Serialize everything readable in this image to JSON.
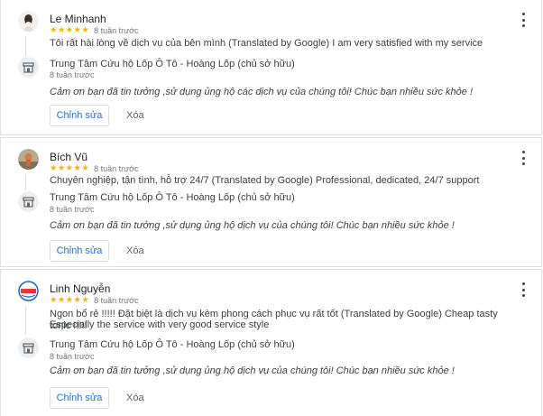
{
  "reviews": [
    {
      "reviewer_name": "Le Minhanh",
      "rating": 5,
      "stars": "★★★★★",
      "time_ago": "8 tuần trước",
      "text": "Tôi rất hài lòng về dịch vụ của bên mình (Translated by Google) I am very satisfied with my service",
      "owner_name": "Trung Tâm Cứu hộ Lốp Ô Tô - Hoàng Lốp (chủ sở hữu)",
      "owner_time_ago": "8 tuần trước",
      "owner_reply": "Cảm ơn bạn đã tin tưởng ,sử dụng ủng hộ các dịch vụ của chúng tôi! Chúc bạn nhiều sức khỏe !",
      "edit_label": "Chỉnh sửa",
      "delete_label": "Xóa"
    },
    {
      "reviewer_name": "Bích Vũ",
      "rating": 5,
      "stars": "★★★★★",
      "time_ago": "8 tuần trước",
      "text": "Chuyên nghiệp, tận tình, hỗ trợ 24/7 (Translated by Google) Professional, dedicated, 24/7 support",
      "owner_name": "Trung Tâm Cứu hộ Lốp Ô Tô - Hoàng Lốp (chủ sở hữu)",
      "owner_time_ago": "8 tuần trước",
      "owner_reply": "Cảm ơn bạn đã tin tưởng ,sử dụng ủng hộ dịch vụ của chúng tôi! Chúc bạn nhiều sức khỏe !",
      "edit_label": "Chỉnh sửa",
      "delete_label": "Xóa"
    },
    {
      "reviewer_name": "Linh Nguyễn",
      "rating": 5,
      "stars": "★★★★★",
      "time_ago": "8 tuần trước",
      "text_line1": "Ngon bổ rẻ !!!!! Đặt biệt là dịch vụ kèm phong cách phục vụ rất tốt (Translated by Google) Cheap tasty tonic !!!!!",
      "text_line2": "Especially the service with very good service style",
      "owner_name": "Trung Tâm Cứu hộ Lốp Ô Tô - Hoàng Lốp (chủ sở hữu)",
      "owner_time_ago": "8 tuần trước",
      "owner_reply": "Cảm ơn bạn đã tin tưởng ,sử dụng ủng hộ dịch vụ của chúng tôi! Chúc bạn nhiều sức khỏe !",
      "edit_label": "Chỉnh sửa",
      "delete_label": "Xóa"
    }
  ],
  "colors": {
    "star": "#f4b400",
    "edit_button_text": "#1a73e8",
    "divider": "#e0e0e0"
  },
  "icons": {
    "more": "more-vert-icon",
    "owner": "storefront-icon"
  }
}
